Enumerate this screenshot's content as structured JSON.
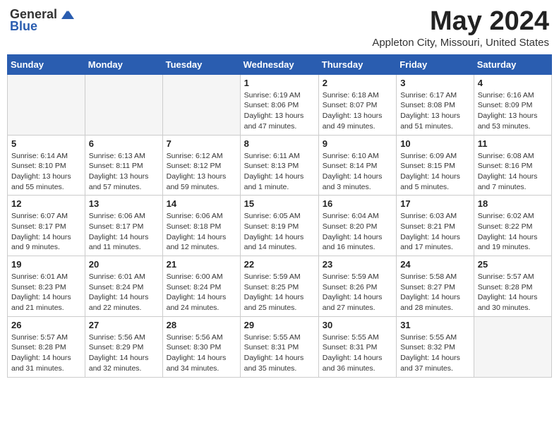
{
  "header": {
    "logo_general": "General",
    "logo_blue": "Blue",
    "month_title": "May 2024",
    "location": "Appleton City, Missouri, United States"
  },
  "days_of_week": [
    "Sunday",
    "Monday",
    "Tuesday",
    "Wednesday",
    "Thursday",
    "Friday",
    "Saturday"
  ],
  "weeks": [
    [
      {
        "day": "",
        "info": ""
      },
      {
        "day": "",
        "info": ""
      },
      {
        "day": "",
        "info": ""
      },
      {
        "day": "1",
        "info": "Sunrise: 6:19 AM\nSunset: 8:06 PM\nDaylight: 13 hours\nand 47 minutes."
      },
      {
        "day": "2",
        "info": "Sunrise: 6:18 AM\nSunset: 8:07 PM\nDaylight: 13 hours\nand 49 minutes."
      },
      {
        "day": "3",
        "info": "Sunrise: 6:17 AM\nSunset: 8:08 PM\nDaylight: 13 hours\nand 51 minutes."
      },
      {
        "day": "4",
        "info": "Sunrise: 6:16 AM\nSunset: 8:09 PM\nDaylight: 13 hours\nand 53 minutes."
      }
    ],
    [
      {
        "day": "5",
        "info": "Sunrise: 6:14 AM\nSunset: 8:10 PM\nDaylight: 13 hours\nand 55 minutes."
      },
      {
        "day": "6",
        "info": "Sunrise: 6:13 AM\nSunset: 8:11 PM\nDaylight: 13 hours\nand 57 minutes."
      },
      {
        "day": "7",
        "info": "Sunrise: 6:12 AM\nSunset: 8:12 PM\nDaylight: 13 hours\nand 59 minutes."
      },
      {
        "day": "8",
        "info": "Sunrise: 6:11 AM\nSunset: 8:13 PM\nDaylight: 14 hours\nand 1 minute."
      },
      {
        "day": "9",
        "info": "Sunrise: 6:10 AM\nSunset: 8:14 PM\nDaylight: 14 hours\nand 3 minutes."
      },
      {
        "day": "10",
        "info": "Sunrise: 6:09 AM\nSunset: 8:15 PM\nDaylight: 14 hours\nand 5 minutes."
      },
      {
        "day": "11",
        "info": "Sunrise: 6:08 AM\nSunset: 8:16 PM\nDaylight: 14 hours\nand 7 minutes."
      }
    ],
    [
      {
        "day": "12",
        "info": "Sunrise: 6:07 AM\nSunset: 8:17 PM\nDaylight: 14 hours\nand 9 minutes."
      },
      {
        "day": "13",
        "info": "Sunrise: 6:06 AM\nSunset: 8:17 PM\nDaylight: 14 hours\nand 11 minutes."
      },
      {
        "day": "14",
        "info": "Sunrise: 6:06 AM\nSunset: 8:18 PM\nDaylight: 14 hours\nand 12 minutes."
      },
      {
        "day": "15",
        "info": "Sunrise: 6:05 AM\nSunset: 8:19 PM\nDaylight: 14 hours\nand 14 minutes."
      },
      {
        "day": "16",
        "info": "Sunrise: 6:04 AM\nSunset: 8:20 PM\nDaylight: 14 hours\nand 16 minutes."
      },
      {
        "day": "17",
        "info": "Sunrise: 6:03 AM\nSunset: 8:21 PM\nDaylight: 14 hours\nand 17 minutes."
      },
      {
        "day": "18",
        "info": "Sunrise: 6:02 AM\nSunset: 8:22 PM\nDaylight: 14 hours\nand 19 minutes."
      }
    ],
    [
      {
        "day": "19",
        "info": "Sunrise: 6:01 AM\nSunset: 8:23 PM\nDaylight: 14 hours\nand 21 minutes."
      },
      {
        "day": "20",
        "info": "Sunrise: 6:01 AM\nSunset: 8:24 PM\nDaylight: 14 hours\nand 22 minutes."
      },
      {
        "day": "21",
        "info": "Sunrise: 6:00 AM\nSunset: 8:24 PM\nDaylight: 14 hours\nand 24 minutes."
      },
      {
        "day": "22",
        "info": "Sunrise: 5:59 AM\nSunset: 8:25 PM\nDaylight: 14 hours\nand 25 minutes."
      },
      {
        "day": "23",
        "info": "Sunrise: 5:59 AM\nSunset: 8:26 PM\nDaylight: 14 hours\nand 27 minutes."
      },
      {
        "day": "24",
        "info": "Sunrise: 5:58 AM\nSunset: 8:27 PM\nDaylight: 14 hours\nand 28 minutes."
      },
      {
        "day": "25",
        "info": "Sunrise: 5:57 AM\nSunset: 8:28 PM\nDaylight: 14 hours\nand 30 minutes."
      }
    ],
    [
      {
        "day": "26",
        "info": "Sunrise: 5:57 AM\nSunset: 8:28 PM\nDaylight: 14 hours\nand 31 minutes."
      },
      {
        "day": "27",
        "info": "Sunrise: 5:56 AM\nSunset: 8:29 PM\nDaylight: 14 hours\nand 32 minutes."
      },
      {
        "day": "28",
        "info": "Sunrise: 5:56 AM\nSunset: 8:30 PM\nDaylight: 14 hours\nand 34 minutes."
      },
      {
        "day": "29",
        "info": "Sunrise: 5:55 AM\nSunset: 8:31 PM\nDaylight: 14 hours\nand 35 minutes."
      },
      {
        "day": "30",
        "info": "Sunrise: 5:55 AM\nSunset: 8:31 PM\nDaylight: 14 hours\nand 36 minutes."
      },
      {
        "day": "31",
        "info": "Sunrise: 5:55 AM\nSunset: 8:32 PM\nDaylight: 14 hours\nand 37 minutes."
      },
      {
        "day": "",
        "info": ""
      }
    ]
  ]
}
